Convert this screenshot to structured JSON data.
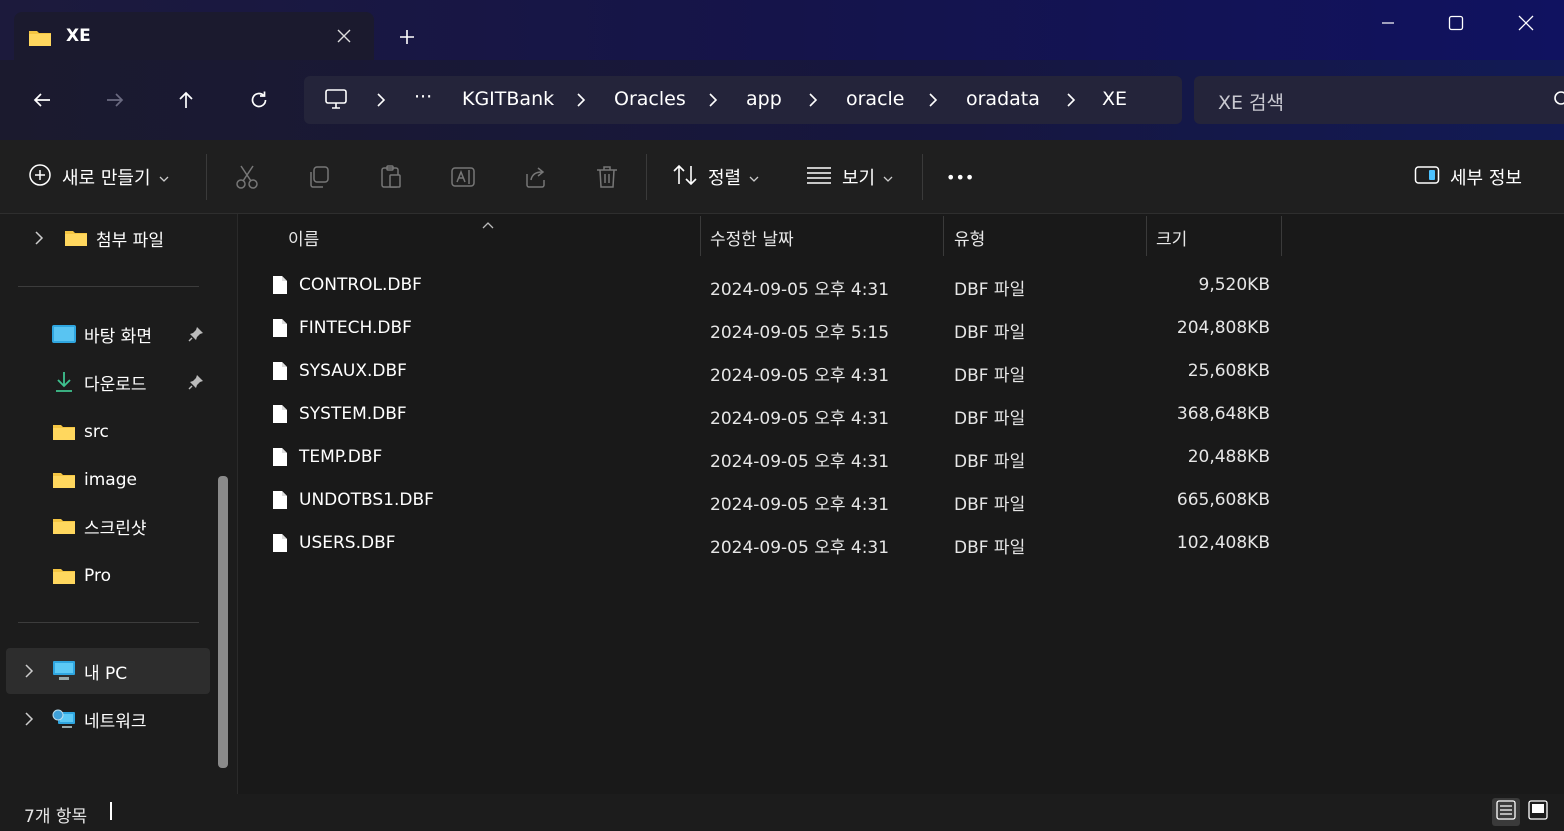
{
  "window": {
    "tab_title": "XE",
    "new_tab_symbol": "+"
  },
  "address": {
    "ellipsis": "···",
    "breadcrumbs": [
      "KGITBank",
      "Oracles",
      "app",
      "oracle",
      "oradata",
      "XE"
    ],
    "search_placeholder": "XE 검색"
  },
  "commandbar": {
    "new_label": "새로 만들기",
    "sort_label": "정렬",
    "view_label": "보기",
    "more_label": "•••",
    "details_label": "세부 정보"
  },
  "sidebar": {
    "top_item": "첨부 파일",
    "quick_access": [
      {
        "label": "바탕 화면",
        "icon": "desktop-icon",
        "pinned": true
      },
      {
        "label": "다운로드",
        "icon": "download-icon",
        "pinned": true
      },
      {
        "label": "src",
        "icon": "folder-icon",
        "pinned": false
      },
      {
        "label": "image",
        "icon": "folder-icon",
        "pinned": false
      },
      {
        "label": "스크린샷",
        "icon": "folder-icon",
        "pinned": false
      },
      {
        "label": "Pro",
        "icon": "folder-icon",
        "pinned": false
      }
    ],
    "this_pc": "내 PC",
    "network": "네트워크"
  },
  "columns": {
    "name": "이름",
    "date": "수정한 날짜",
    "type": "유형",
    "size": "크기"
  },
  "files": [
    {
      "name": "CONTROL.DBF",
      "date": "2024-09-05 오후 4:31",
      "type": "DBF 파일",
      "size": "9,520KB"
    },
    {
      "name": "FINTECH.DBF",
      "date": "2024-09-05 오후 5:15",
      "type": "DBF 파일",
      "size": "204,808KB"
    },
    {
      "name": "SYSAUX.DBF",
      "date": "2024-09-05 오후 4:31",
      "type": "DBF 파일",
      "size": "25,608KB"
    },
    {
      "name": "SYSTEM.DBF",
      "date": "2024-09-05 오후 4:31",
      "type": "DBF 파일",
      "size": "368,648KB"
    },
    {
      "name": "TEMP.DBF",
      "date": "2024-09-05 오후 4:31",
      "type": "DBF 파일",
      "size": "20,488KB"
    },
    {
      "name": "UNDOTBS1.DBF",
      "date": "2024-09-05 오후 4:31",
      "type": "DBF 파일",
      "size": "665,608KB"
    },
    {
      "name": "USERS.DBF",
      "date": "2024-09-05 오후 4:31",
      "type": "DBF 파일",
      "size": "102,408KB"
    }
  ],
  "status": {
    "item_count": "7개 항목"
  },
  "colors": {
    "folder": "#f4c542",
    "accent": "#4cc2ff"
  }
}
